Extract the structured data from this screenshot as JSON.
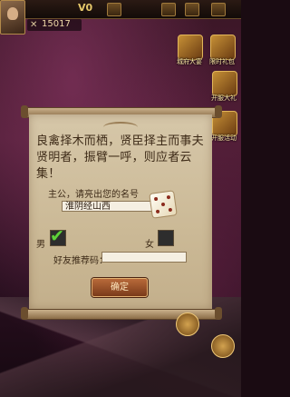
{
  "hud": {
    "vip_label": "V0",
    "power_value": "15017"
  },
  "side_menu": {
    "items": [
      {
        "label": "城府大宴"
      },
      {
        "label": "限时礼包"
      },
      {
        "label": "开服大礼"
      },
      {
        "label": "开服活动"
      }
    ]
  },
  "dialog": {
    "intro_text": "良禽择木而栖，贤臣择主而事夫贤明者，振臂一呼，则应者云集！",
    "name_prompt": "主公，请亮出您的名号",
    "name_value": "淮阴经山西",
    "male_label": "男",
    "female_label": "女",
    "male_selected": true,
    "referral_label": "好友推荐码：",
    "referral_value": "",
    "confirm_label": "确定"
  },
  "colors": {
    "scroll_paper": "#d6c7a9",
    "button": "#8a4422",
    "check": "#5fd13a",
    "text": "#3d2a17"
  }
}
